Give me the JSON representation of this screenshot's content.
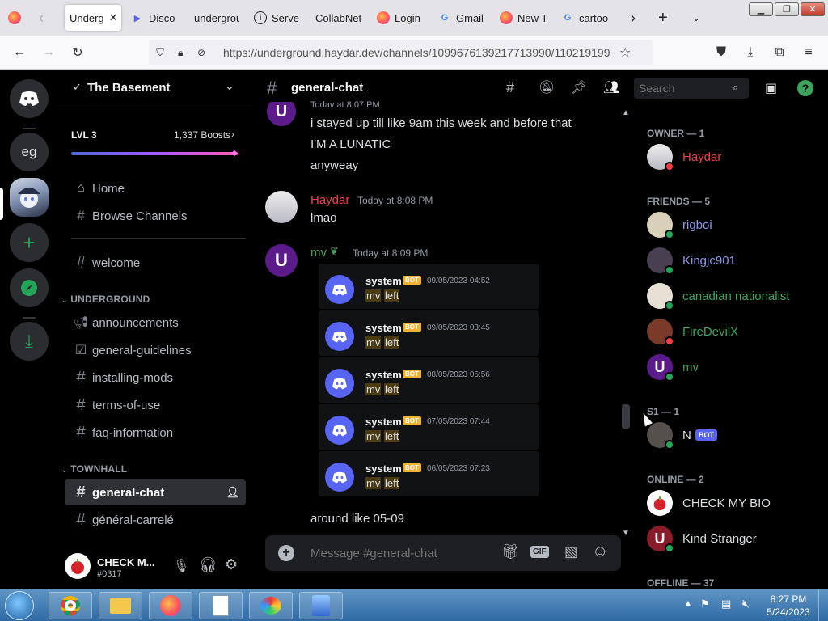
{
  "browser": {
    "tabs": [
      {
        "label": "Underg",
        "icon": "firefox-icon"
      },
      {
        "label": "Disco",
        "icon": "play-icon"
      },
      {
        "label": "undergrou",
        "icon": "underground-icon"
      },
      {
        "label": "Server",
        "icon": "info-icon"
      },
      {
        "label": "CollabNet",
        "icon": "collabnet-icon"
      },
      {
        "label": "Login",
        "icon": "firefox-icon"
      },
      {
        "label": "Gmail",
        "icon": "google-icon"
      },
      {
        "label": "New T",
        "icon": "firefox-icon"
      },
      {
        "label": "cartoo",
        "icon": "google-icon"
      }
    ],
    "url": "https://underground.haydar.dev/channels/1099676139217713990/110219199"
  },
  "server": {
    "name": "The Basement",
    "level": "LVL 3",
    "boosts": "1,337 Boosts",
    "rail_labels": {
      "eg": "eg"
    }
  },
  "sidebar": {
    "top_items": [
      "Home",
      "Browse Channels"
    ],
    "welcome": "welcome",
    "categories": [
      "UNDERGROUND",
      "TOWNHALL"
    ],
    "underground_channels": [
      "announcements",
      "general-guidelines",
      "installing-mods",
      "terms-of-use",
      "faq-information"
    ],
    "townhall_channels": [
      "general-chat",
      "général-carrelé"
    ]
  },
  "user": {
    "name": "CHECK M...",
    "tag": "#0317"
  },
  "chat": {
    "channel": "general-chat",
    "search_placeholder": "Search",
    "partial_header": "Today at 8:07 PM",
    "lines_mv": [
      "i stayed up till like 9am this week and before that",
      "I'M A LUNATIC",
      "anyweay"
    ],
    "haydar": {
      "name": "Haydar",
      "time": "Today at 8:08 PM",
      "text": "lmao"
    },
    "mv": {
      "name": "mv",
      "time": "Today at 8:09 PM",
      "after": "around like 05-09"
    },
    "embeds": [
      {
        "name": "system",
        "bot": "BOT",
        "time": "09/05/2023 04:52",
        "w1": "mv",
        "w2": "left"
      },
      {
        "name": "system",
        "bot": "BOT",
        "time": "09/05/2023 03:45",
        "w1": "mv",
        "w2": "left"
      },
      {
        "name": "system",
        "bot": "BOT",
        "time": "08/05/2023 05:56",
        "w1": "mv",
        "w2": "left"
      },
      {
        "name": "system",
        "bot": "BOT",
        "time": "07/05/2023 07:44",
        "w1": "mv",
        "w2": "left"
      },
      {
        "name": "system",
        "bot": "BOT",
        "time": "06/05/2023 07:23",
        "w1": "mv",
        "w2": "left"
      }
    ],
    "input_placeholder": "Message #general-chat",
    "gif": "GIF"
  },
  "members": {
    "groups": [
      "OWNER — 1",
      "FRIENDS — 5",
      "S1 — 1",
      "ONLINE — 2",
      "OFFLINE — 37"
    ],
    "owner": {
      "name": "Haydar",
      "color": "#ed4245"
    },
    "friends": [
      {
        "name": "rigboi",
        "color": "#8b96e8"
      },
      {
        "name": "Kingjc901",
        "color": "#8b96e8"
      },
      {
        "name": "canadian nationalist",
        "color": "#3ba55d"
      },
      {
        "name": "FireDevilX",
        "color": "#3ba55d"
      },
      {
        "name": "mv",
        "color": "#3ba55d"
      }
    ],
    "s1": {
      "name": "N",
      "bot": "BOT"
    },
    "online": [
      "CHECK MY BIO",
      "Kind Stranger"
    ]
  },
  "taskbar": {
    "time": "8:27 PM",
    "date": "5/24/2023"
  },
  "colors": {
    "blurple": "#5865f2",
    "online": "#23a55a",
    "dnd": "#f23f43"
  }
}
